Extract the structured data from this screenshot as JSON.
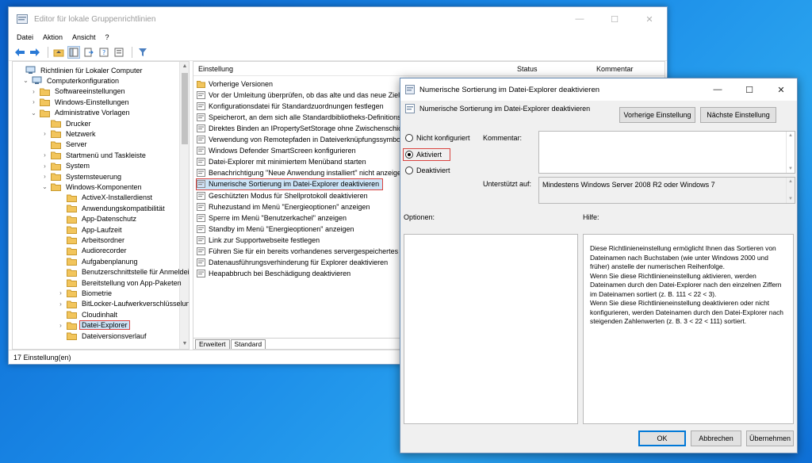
{
  "window": {
    "title": "Editor für lokale Gruppenrichtlinien",
    "controls": {
      "minimize": "—",
      "maximize": "☐",
      "close": "✕"
    },
    "menu": [
      "Datei",
      "Aktion",
      "Ansicht",
      "?"
    ]
  },
  "tree": [
    {
      "label": "Richtlinien für Lokaler Computer",
      "chev": "",
      "indent": 0,
      "icon": "computer"
    },
    {
      "label": "Computerkonfiguration",
      "chev": "⌄",
      "indent": 1,
      "icon": "computer"
    },
    {
      "label": "Softwareeinstellungen",
      "chev": "›",
      "indent": 2,
      "icon": "folder"
    },
    {
      "label": "Windows-Einstellungen",
      "chev": "›",
      "indent": 2,
      "icon": "folder"
    },
    {
      "label": "Administrative Vorlagen",
      "chev": "⌄",
      "indent": 2,
      "icon": "folder"
    },
    {
      "label": "Drucker",
      "chev": "",
      "indent": 3,
      "icon": "folder"
    },
    {
      "label": "Netzwerk",
      "chev": "›",
      "indent": 3,
      "icon": "folder"
    },
    {
      "label": "Server",
      "chev": "",
      "indent": 3,
      "icon": "folder"
    },
    {
      "label": "Startmenü und Taskleiste",
      "chev": "›",
      "indent": 3,
      "icon": "folder"
    },
    {
      "label": "System",
      "chev": "›",
      "indent": 3,
      "icon": "folder"
    },
    {
      "label": "Systemsteuerung",
      "chev": "›",
      "indent": 3,
      "icon": "folder"
    },
    {
      "label": "Windows-Komponenten",
      "chev": "⌄",
      "indent": 3,
      "icon": "folder"
    },
    {
      "label": "ActiveX-Installerdienst",
      "chev": "",
      "indent": 4,
      "icon": "folder"
    },
    {
      "label": "Anwendungskompatibilität",
      "chev": "",
      "indent": 4,
      "icon": "folder"
    },
    {
      "label": "App-Datenschutz",
      "chev": "",
      "indent": 4,
      "icon": "folder"
    },
    {
      "label": "App-Laufzeit",
      "chev": "",
      "indent": 4,
      "icon": "folder"
    },
    {
      "label": "Arbeitsordner",
      "chev": "",
      "indent": 4,
      "icon": "folder"
    },
    {
      "label": "Audiorecorder",
      "chev": "",
      "indent": 4,
      "icon": "folder"
    },
    {
      "label": "Aufgabenplanung",
      "chev": "",
      "indent": 4,
      "icon": "folder"
    },
    {
      "label": "Benutzerschnittstelle für Anmeldeir",
      "chev": "",
      "indent": 4,
      "icon": "folder"
    },
    {
      "label": "Bereitstellung von App-Paketen",
      "chev": "",
      "indent": 4,
      "icon": "folder"
    },
    {
      "label": "Biometrie",
      "chev": "›",
      "indent": 4,
      "icon": "folder"
    },
    {
      "label": "BitLocker-Laufwerkverschlüsselung",
      "chev": "›",
      "indent": 4,
      "icon": "folder"
    },
    {
      "label": "Cloudinhalt",
      "chev": "",
      "indent": 4,
      "icon": "folder"
    },
    {
      "label": "Datei-Explorer",
      "chev": "›",
      "indent": 4,
      "icon": "folder",
      "selected": true
    },
    {
      "label": "Dateiversionsverlauf",
      "chev": "",
      "indent": 4,
      "icon": "folder"
    }
  ],
  "list": {
    "headers": {
      "setting": "Einstellung",
      "status": "Status",
      "comment": "Kommentar"
    },
    "rows": [
      {
        "label": "Vorherige Versionen",
        "icon": "folder"
      },
      {
        "label": "Vor der Umleitung überprüfen, ob das alte und das neue Ziel d",
        "icon": "policy"
      },
      {
        "label": "Konfigurationsdatei für Standardzuordnungen festlegen",
        "icon": "policy"
      },
      {
        "label": "Speicherort, an dem sich alle Standardbibliotheks-Definitionsd",
        "icon": "policy"
      },
      {
        "label": "Direktes Binden an IPropertySetStorage ohne Zwischenschichten",
        "icon": "policy"
      },
      {
        "label": "Verwendung von Remotepfaden in Dateiverknüpfungssymbolen",
        "icon": "policy"
      },
      {
        "label": "Windows Defender SmartScreen konfigurieren",
        "icon": "policy"
      },
      {
        "label": "Datei-Explorer mit minimiertem Menüband starten",
        "icon": "policy"
      },
      {
        "label": "Benachrichtigung \"Neue Anwendung installiert\" nicht anzeigen",
        "icon": "policy"
      },
      {
        "label": "Numerische Sortierung im Datei-Explorer deaktivieren",
        "icon": "policy-on",
        "selected": true
      },
      {
        "label": "Geschützten Modus für Shellprotokoll deaktivieren",
        "icon": "policy"
      },
      {
        "label": "Ruhezustand im Menü \"Energieoptionen\" anzeigen",
        "icon": "policy"
      },
      {
        "label": "Sperre im Menü \"Benutzerkachel\" anzeigen",
        "icon": "policy"
      },
      {
        "label": "Standby im Menü \"Energieoptionen\" anzeigen",
        "icon": "policy"
      },
      {
        "label": "Link zur Supportwebseite festlegen",
        "icon": "policy"
      },
      {
        "label": "Führen Sie für ein bereits vorhandenes servergespeichertes Benu",
        "icon": "policy"
      },
      {
        "label": "Datenausführungsverhinderung für Explorer deaktivieren",
        "icon": "policy"
      },
      {
        "label": "Heapabbruch bei Beschädigung deaktivieren",
        "icon": "policy"
      }
    ],
    "tabs": [
      "Erweitert",
      "Standard"
    ]
  },
  "status_bar": "17 Einstellung(en)",
  "dialog": {
    "title": "Numerische Sortierung im Datei-Explorer deaktivieren",
    "subtitle": "Numerische Sortierung im Datei-Explorer deaktivieren",
    "controls": {
      "minimize": "—",
      "maximize": "☐",
      "close": "✕"
    },
    "prev_button": "Vorherige Einstellung",
    "next_button": "Nächste Einstellung",
    "radios": [
      {
        "label": "Nicht konfiguriert",
        "checked": false
      },
      {
        "label": "Aktiviert",
        "checked": true
      },
      {
        "label": "Deaktiviert",
        "checked": false
      }
    ],
    "comment_label": "Kommentar:",
    "comment_value": "",
    "supported_label": "Unterstützt auf:",
    "supported_value": "Mindestens Windows Server 2008 R2 oder Windows 7",
    "options_label": "Optionen:",
    "help_label": "Hilfe:",
    "help_paragraphs": [
      "Diese Richtlinieneinstellung ermöglicht Ihnen das Sortieren von Dateinamen nach Buchstaben (wie unter Windows 2000 und früher) anstelle der numerischen Reihenfolge.",
      "Wenn Sie diese Richtlinieneinstellung aktivieren, werden Dateinamen durch den Datei-Explorer nach den einzelnen Ziffern im Dateinamen sortiert (z. B. 111 < 22 < 3).",
      "Wenn Sie diese Richtlinieneinstellung deaktivieren oder nicht konfigurieren, werden Dateinamen durch den Datei-Explorer nach steigenden Zahlenwerten (z. B. 3 < 22 < 111) sortiert."
    ],
    "ok": "OK",
    "cancel": "Abbrechen",
    "apply": "Übernehmen"
  },
  "colors": {
    "selection": "#cce4f7",
    "highlight_frame": "#d9433f",
    "folder": "#f2c55c",
    "desktop": "#1a8ae8"
  }
}
